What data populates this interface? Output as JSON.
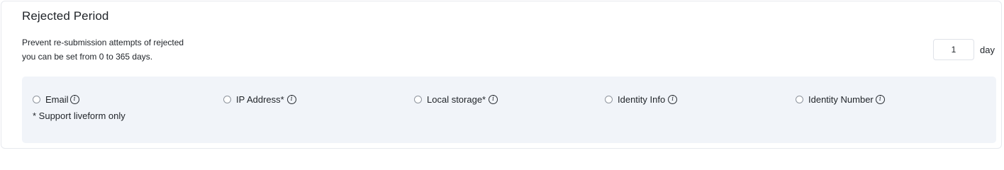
{
  "section": {
    "title": "Rejected Period",
    "description_line1": "Prevent re-submission attempts of rejected",
    "description_line2": "you can be set from 0 to 365 days."
  },
  "period": {
    "value": "1",
    "unit": "day"
  },
  "options": [
    {
      "label": "Email",
      "info_glyph": "i",
      "selected": false
    },
    {
      "label": "IP Address*",
      "info_glyph": "i",
      "selected": false
    },
    {
      "label": "Local storage*",
      "info_glyph": "i",
      "selected": false
    },
    {
      "label": "Identity Info",
      "info_glyph": "i",
      "selected": false
    },
    {
      "label": "Identity Number",
      "info_glyph": "i",
      "selected": false
    }
  ],
  "footnote": "* Support liveform only",
  "icons": {
    "info": "info-circle-icon",
    "radio": "radio-unchecked"
  },
  "colors": {
    "panel_background": "#f1f4f9",
    "border": "#e7e9ee",
    "text": "#1f2328"
  }
}
